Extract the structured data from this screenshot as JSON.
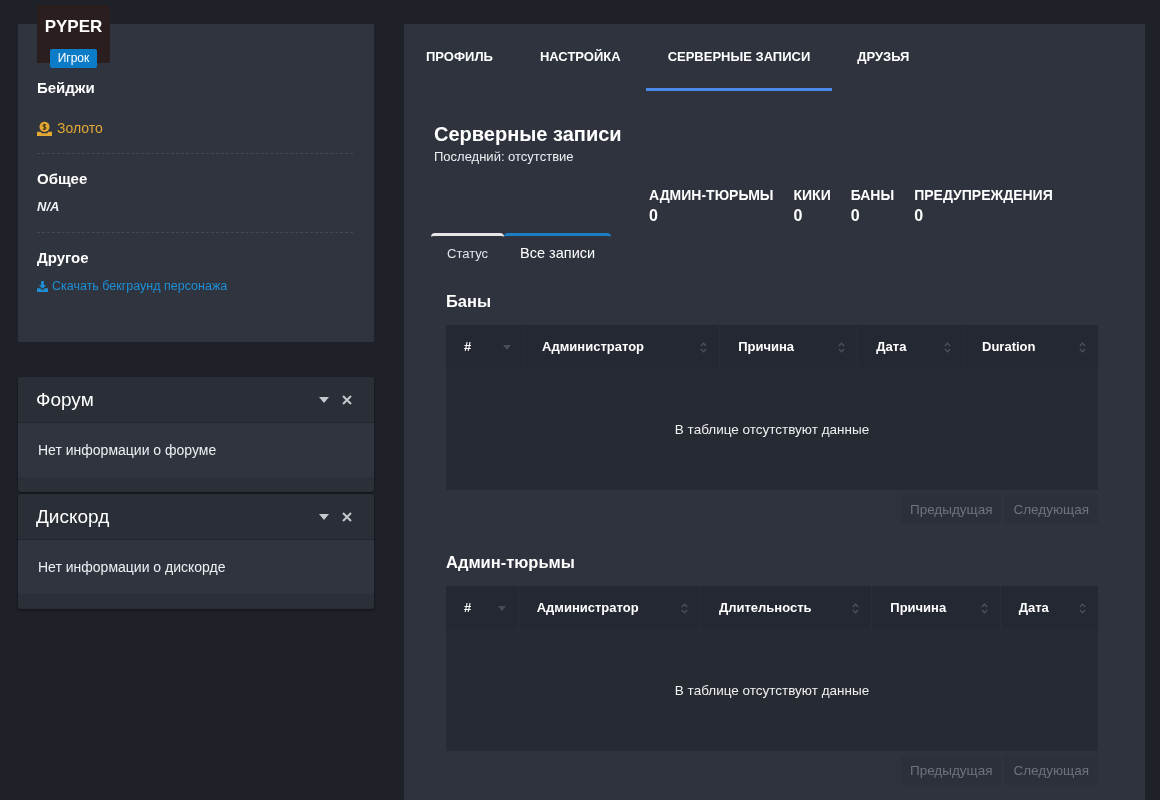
{
  "profile": {
    "name": "PYPER",
    "role": "Игрок",
    "sections": [
      {
        "title": "Бейджи",
        "kind": "badge",
        "text": "Золото"
      },
      {
        "title": "Общее",
        "kind": "note",
        "text": "N/A"
      },
      {
        "title": "Другое",
        "kind": "download",
        "text": "Скачать бекграунд персонажа"
      }
    ]
  },
  "widgets": [
    {
      "title": "Форум",
      "message": "Нет информации о форуме"
    },
    {
      "title": "Дискорд",
      "message": "Нет информации о дискорде"
    }
  ],
  "tabs": [
    {
      "label": "ПРОФИЛЬ",
      "selected": false
    },
    {
      "label": "НАСТРОЙКА",
      "selected": false
    },
    {
      "label": "СЕРВЕРНЫЕ ЗАПИСИ",
      "selected": true
    },
    {
      "label": "ДРУЗЬЯ",
      "selected": false
    }
  ],
  "records": {
    "title": "Серверные записи",
    "subtitle": "Последний: отсутствие",
    "stats": [
      {
        "label": "АДМИН-ТЮРЬМЫ",
        "value": "0"
      },
      {
        "label": "КИКИ",
        "value": "0"
      },
      {
        "label": "БАНЫ",
        "value": "0"
      },
      {
        "label": "ПРЕДУПРЕЖДЕНИЯ",
        "value": "0"
      }
    ],
    "subtabs": [
      {
        "label": "Статус",
        "selected": false
      },
      {
        "label": "Все записи",
        "selected": true
      }
    ],
    "tables": [
      {
        "title": "Баны",
        "columns": [
          {
            "label": "#",
            "sorted": true
          },
          {
            "label": "Администратор",
            "sorted": false
          },
          {
            "label": "Причина",
            "sorted": false
          },
          {
            "label": "Дата",
            "sorted": false
          },
          {
            "label": "Duration",
            "sorted": false
          }
        ],
        "empty_message": "В таблице отсутствуют данные",
        "pager": [
          {
            "label": "Предыдущая",
            "disabled": true
          },
          {
            "label": "Следующая",
            "disabled": true
          }
        ]
      },
      {
        "title": "Админ-тюрьмы",
        "columns": [
          {
            "label": "#",
            "sorted": true
          },
          {
            "label": "Администратор",
            "sorted": false
          },
          {
            "label": "Длительность",
            "sorted": false
          },
          {
            "label": "Причина",
            "sorted": false
          },
          {
            "label": "Дата",
            "sorted": false
          }
        ],
        "empty_message": "В таблице отсутствуют данные",
        "pager": [
          {
            "label": "Предыдущая",
            "disabled": true
          },
          {
            "label": "Следующая",
            "disabled": true
          }
        ]
      }
    ]
  }
}
